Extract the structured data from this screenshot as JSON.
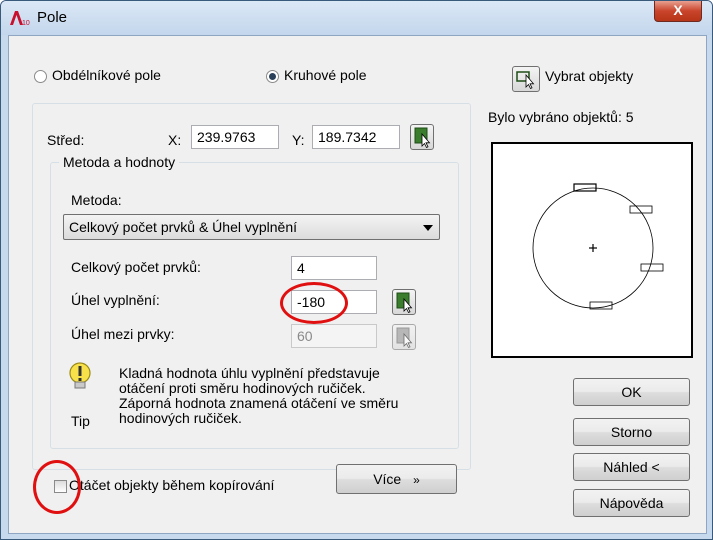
{
  "window": {
    "title": "Pole",
    "app_icon": "autocad-icon",
    "close_label": "X"
  },
  "array_type": {
    "rectangular": {
      "label": "Obdélníkové pole",
      "selected": false
    },
    "polar": {
      "label": "Kruhové pole",
      "selected": true
    }
  },
  "center": {
    "label": "Střed:",
    "x_label": "X:",
    "x_value": "239.9763",
    "y_label": "Y:",
    "y_value": "189.7342"
  },
  "method_group": {
    "title": "Metoda a hodnoty",
    "method_label": "Metoda:",
    "method_value": "Celkový počet prvků & Úhel vyplnění"
  },
  "fields": {
    "total_items_label": "Celkový počet prvků:",
    "total_items_value": "4",
    "fill_angle_label": "Úhel vyplnění:",
    "fill_angle_value": "-180",
    "angle_between_label": "Úhel mezi prvky:",
    "angle_between_value": "60"
  },
  "tip": {
    "label": "Tip",
    "lines": [
      "Kladná hodnota úhlu vyplnění představuje",
      "otáčení proti směru hodinových ručiček.",
      "Záporná hodnota znamená otáčení ve směru",
      "hodinových ručiček."
    ]
  },
  "rotate_checkbox": {
    "label": "Otáčet objekty během kopírování",
    "checked": false
  },
  "more_button": {
    "label": "Více",
    "icon": "double-chevron-down-icon"
  },
  "select_objects": {
    "label": "Vybrat objekty",
    "count_text": "Bylo vybráno objektů: 5"
  },
  "buttons": {
    "ok": "OK",
    "cancel": "Storno",
    "preview": "Náhled <",
    "help": "Nápověda"
  },
  "colors": {
    "highlight_ring": "#e01010",
    "title_bar": "#c7d9ec",
    "close_button": "#c9442b"
  }
}
